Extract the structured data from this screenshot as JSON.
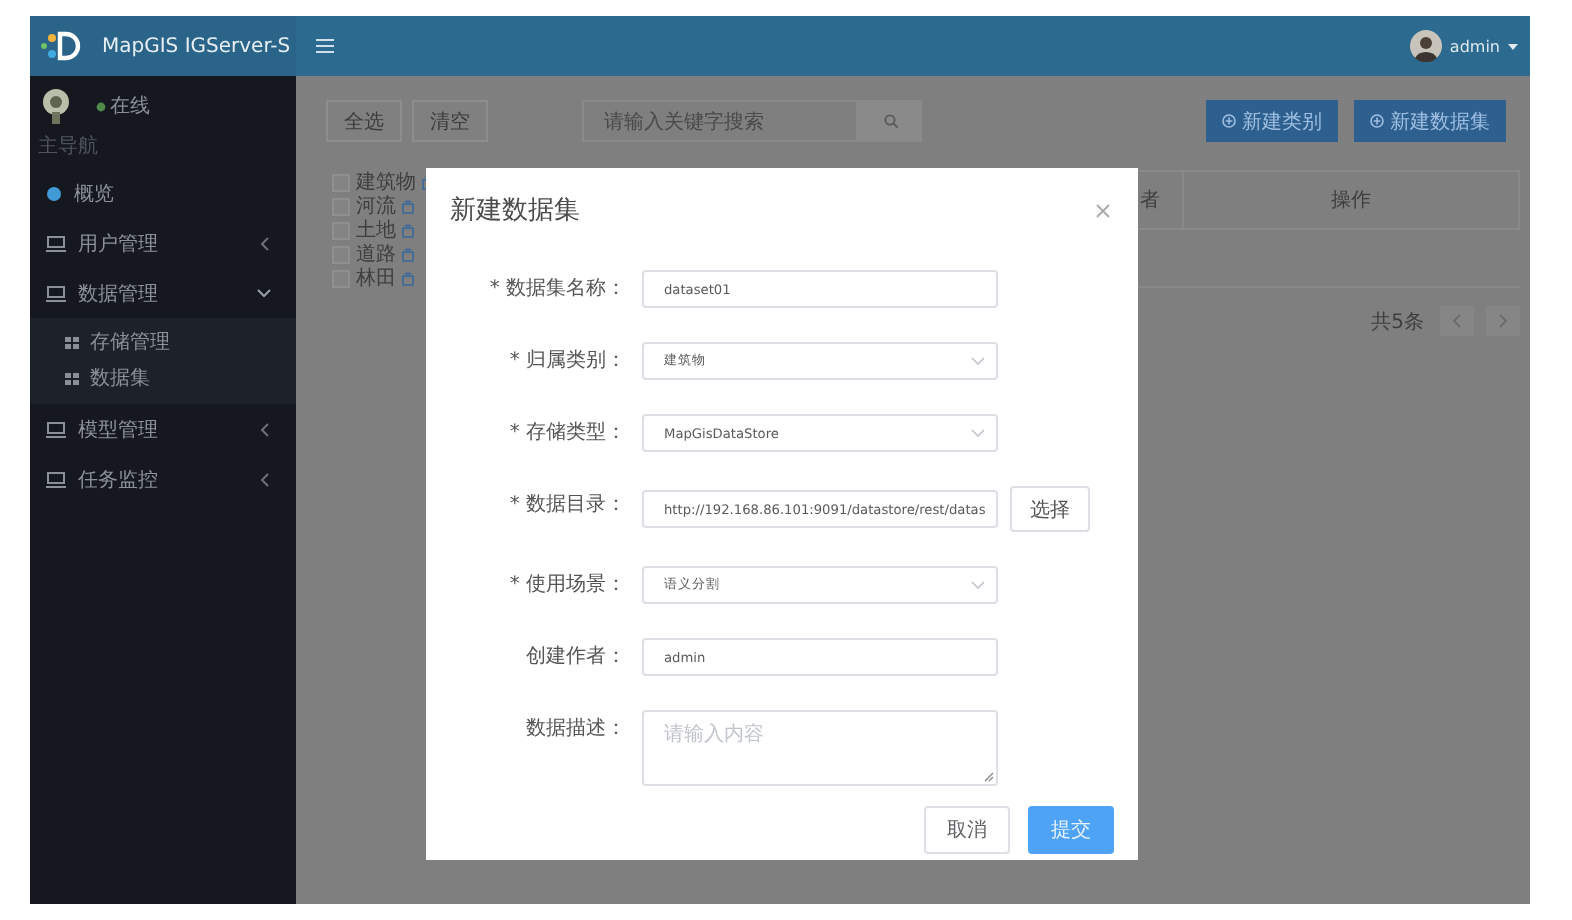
{
  "header": {
    "app_name": "MapGIS IGServer-S",
    "user": "admin"
  },
  "sidebar": {
    "status": "在线",
    "section_label": "主导航",
    "items": [
      {
        "label": "概览",
        "kind": "dot"
      },
      {
        "label": "用户管理",
        "kind": "group",
        "expanded": false
      },
      {
        "label": "数据管理",
        "kind": "group",
        "expanded": true,
        "children": [
          {
            "label": "存储管理"
          },
          {
            "label": "数据集"
          }
        ]
      },
      {
        "label": "模型管理",
        "kind": "group",
        "expanded": false
      },
      {
        "label": "任务监控",
        "kind": "group",
        "expanded": false
      }
    ]
  },
  "toolbar": {
    "buttons": [
      "全选",
      "清空"
    ],
    "search": {
      "placeholder": "请输入关键字搜索"
    },
    "actions": [
      "新建类别",
      "新建数据集"
    ]
  },
  "categories": [
    {
      "label": "建筑物",
      "checked": false
    },
    {
      "label": "河流",
      "checked": false
    },
    {
      "label": "土地",
      "checked": false
    },
    {
      "label": "道路",
      "checked": false
    },
    {
      "label": "林田",
      "checked": false
    }
  ],
  "table": {
    "columns": [
      "者",
      "操作"
    ],
    "total": "共5条"
  },
  "dialog": {
    "title": "新建数据集",
    "fields": [
      {
        "label": "* 数据集名称：",
        "kind": "input",
        "value": "dataset01"
      },
      {
        "label": "* 归属类别：",
        "kind": "select",
        "value": "建筑物"
      },
      {
        "label": "* 存储类型：",
        "kind": "select",
        "value": "MapGisDataStore"
      },
      {
        "label": "* 数据目录：",
        "kind": "input",
        "value": "http://192.168.86.101:9091/datastore/rest/datas",
        "button": "选择"
      },
      {
        "label": "* 使用场景：",
        "kind": "select",
        "value": "语义分割"
      },
      {
        "label": "创建作者：",
        "kind": "input",
        "value": "admin"
      },
      {
        "label": "数据描述：",
        "kind": "textarea",
        "placeholder": "请输入内容"
      }
    ],
    "buttons": [
      "取消",
      "提交"
    ]
  }
}
